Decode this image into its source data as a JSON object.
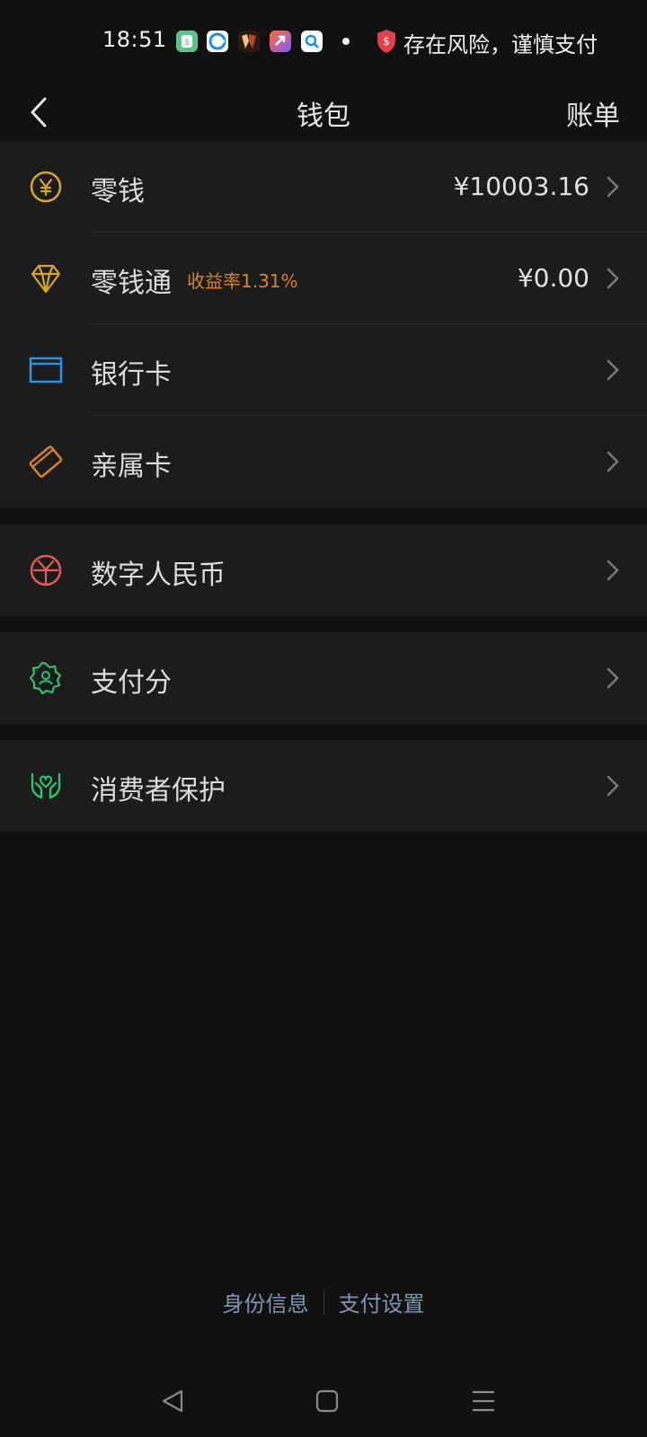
{
  "status_bar": {
    "time": "18:51",
    "risk_text": "存在风险，谨慎支付",
    "app_icons": [
      "money-app-icon",
      "browser-app-icon",
      "game-app-icon",
      "shortcut-app-icon",
      "search-app-icon"
    ]
  },
  "header": {
    "title": "钱包",
    "bill_label": "账单"
  },
  "groups": [
    {
      "items": [
        {
          "label": "零钱",
          "value": "¥10003.16",
          "icon": "yuan-coin-icon",
          "color": "#d4a72c"
        },
        {
          "label": "零钱通",
          "tag": "收益率1.31%",
          "value": "¥0.00",
          "icon": "diamond-icon",
          "color": "#d4a72c"
        },
        {
          "label": "银行卡",
          "icon": "bank-card-icon",
          "color": "#2f8fe0"
        },
        {
          "label": "亲属卡",
          "icon": "family-card-icon",
          "color": "#d9822b"
        }
      ]
    },
    {
      "items": [
        {
          "label": "数字人民币",
          "icon": "digital-rmb-icon",
          "color": "#e25b5b"
        }
      ]
    },
    {
      "items": [
        {
          "label": "支付分",
          "icon": "pay-score-icon",
          "color": "#2fbf71"
        }
      ]
    },
    {
      "items": [
        {
          "label": "消费者保护",
          "icon": "consumer-protection-icon",
          "color": "#2fbf71"
        }
      ]
    }
  ],
  "footer": {
    "identity_label": "身份信息",
    "pay_settings_label": "支付设置"
  },
  "nav": [
    "back-nav-icon",
    "home-nav-icon",
    "menu-nav-icon"
  ]
}
